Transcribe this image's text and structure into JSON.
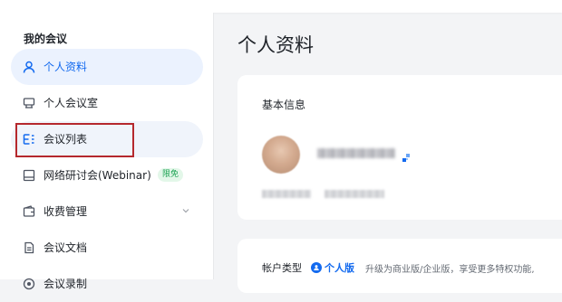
{
  "sidebar": {
    "title": "我的会议",
    "items": [
      {
        "label": "个人资料",
        "icon": "person-icon",
        "active": true
      },
      {
        "label": "个人会议室",
        "icon": "meeting-room-icon"
      },
      {
        "label": "会议列表",
        "icon": "list-icon",
        "highlighted": true
      },
      {
        "label": "网络研讨会(Webinar)",
        "icon": "webinar-icon",
        "badge": "限免"
      },
      {
        "label": "收费管理",
        "icon": "wallet-icon",
        "expandable": true
      },
      {
        "label": "会议文档",
        "icon": "document-icon"
      },
      {
        "label": "会议录制",
        "icon": "record-icon"
      }
    ]
  },
  "main": {
    "title": "个人资料",
    "basic_info": {
      "title": "基本信息"
    },
    "account": {
      "type_label": "帐户类型",
      "type_value": "个人版",
      "upgrade_hint": "升级为商业版/企业版，享受更多特权功能,"
    }
  },
  "colors": {
    "accent": "#136aef",
    "active_bg": "#ebf2fe",
    "badge_bg": "#e3f7e9",
    "badge_text": "#1aa251",
    "highlight_border": "#b5282d"
  }
}
